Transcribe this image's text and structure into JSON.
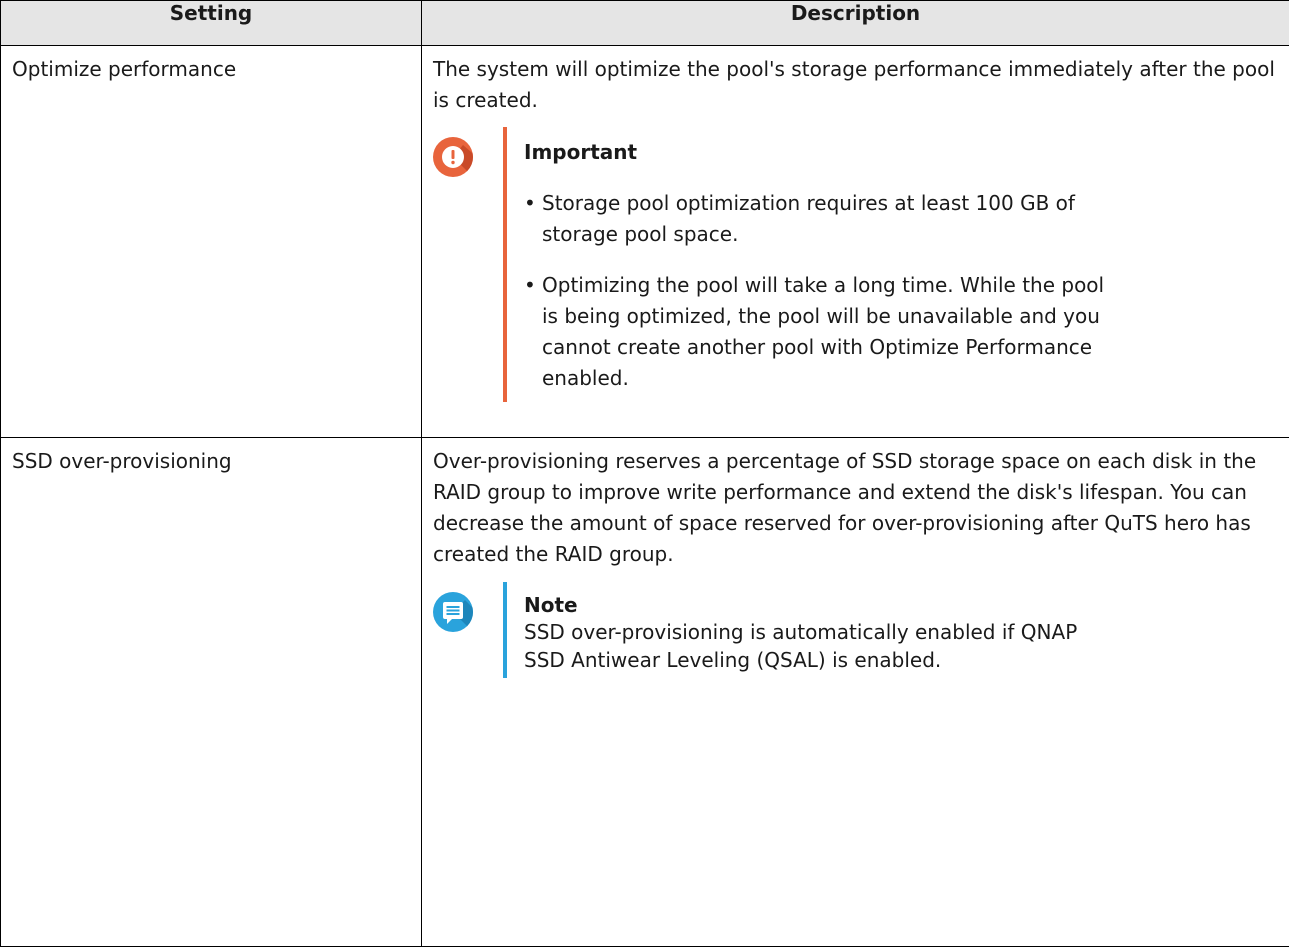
{
  "table": {
    "headers": {
      "setting": "Setting",
      "description": "Description"
    },
    "rows": [
      {
        "setting": "Optimize performance",
        "description": "The system will optimize the pool's storage performance immediately after the pool is created.",
        "callout": {
          "kind": "important",
          "icon": "exclamation-icon",
          "color": "#e8643c",
          "title": "Important",
          "items": [
            "Storage pool optimization requires at least 100 GB of storage pool space.",
            "Optimizing the pool will take a long time. While the pool is being optimized, the pool will be unavailable and you cannot create another pool with Optimize Performance enabled."
          ]
        }
      },
      {
        "setting": "SSD over-provisioning",
        "description": "Over-provisioning reserves a percentage of SSD storage space on each disk in the RAID group to improve write performance and extend the disk's lifespan. You can decrease the amount of space reserved for over-provisioning after QuTS hero has created the RAID group.",
        "callout": {
          "kind": "note",
          "icon": "note-icon",
          "color": "#2aa3dc",
          "title": "Note",
          "text": "SSD over-provisioning is automatically enabled if QNAP SSD Antiwear Leveling (QSAL) is enabled."
        }
      }
    ]
  }
}
